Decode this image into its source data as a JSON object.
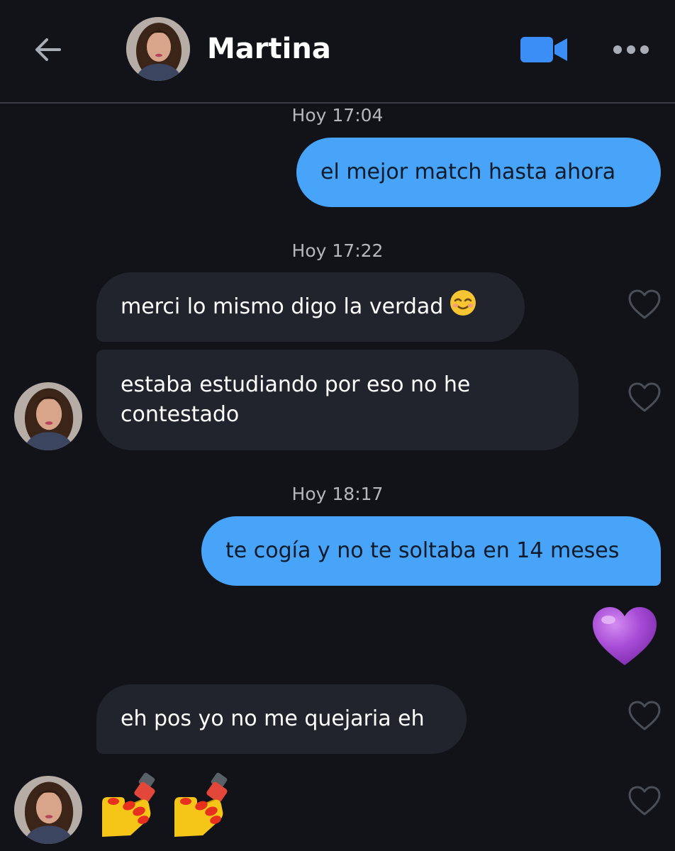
{
  "header": {
    "contact_name": "Martina",
    "back_icon": "arrow-left-icon",
    "video_icon": "video-camera-icon",
    "more_icon": "more-horizontal-icon"
  },
  "colors": {
    "background": "#111318",
    "sent_bubble": "#47a4f9",
    "received_bubble": "#21242c",
    "accent": "#3a8ef6"
  },
  "timestamps": {
    "t1": "Hoy 17:04",
    "t2": "Hoy 17:22",
    "t3": "Hoy 18:17"
  },
  "messages": {
    "m1": "el mejor match hasta ahora",
    "m2": "merci lo mismo digo la verdad",
    "m3_line1": "estaba estudiando por eso no he",
    "m3_line2": "contestado",
    "m4": "te cogía y no te soltaba en 14 meses",
    "m5": "eh pos yo no me quejaria eh"
  },
  "emoji_messages": {
    "smile": "smiling-face-icon",
    "purple_heart": "purple-heart-icon",
    "nail_polish": "nail-polish-icon"
  }
}
